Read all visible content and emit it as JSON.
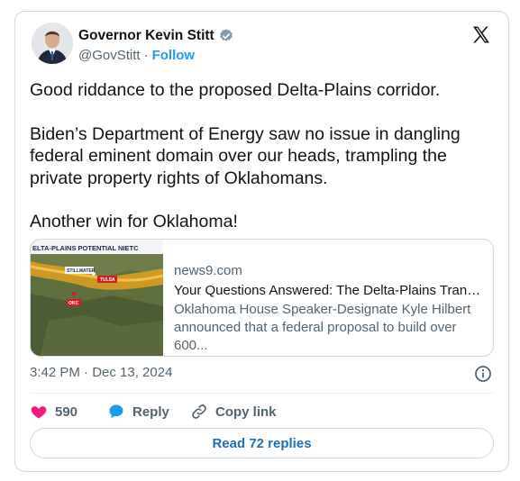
{
  "author": {
    "name": "Governor Kevin Stitt",
    "handle": "@GovStitt",
    "separator": "·",
    "follow_label": "Follow"
  },
  "tweet": {
    "paragraphs": [
      "Good riddance to the proposed Delta-Plains corridor.",
      "Biden’s Department of Energy saw no issue in dangling federal eminent domain over our heads, trampling the private property rights of Oklahomans.",
      "Another win for Oklahoma!"
    ]
  },
  "link_card": {
    "thumbnail_caption": "ELTA-PLAINS POTENTIAL NIETC",
    "map_labels": [
      "STILLWATER",
      "TULSA",
      "OKC"
    ],
    "domain": "news9.com",
    "title": "Your Questions Answered: The Delta-Plains Transmiss...",
    "description": "Oklahoma House Speaker-Designate Kyle Hilbert announced that a federal proposal to build over 600..."
  },
  "meta": {
    "timestamp": "3:42 PM · Dec 13, 2024"
  },
  "actions": {
    "like_count": "590",
    "reply_label": "Reply",
    "copy_label": "Copy link"
  },
  "read_replies_label": "Read 72 replies",
  "colors": {
    "like": "#f91880",
    "reply": "#1d9bf0",
    "link": "#1d9bf0",
    "read_replies": "#1d6fb8"
  }
}
